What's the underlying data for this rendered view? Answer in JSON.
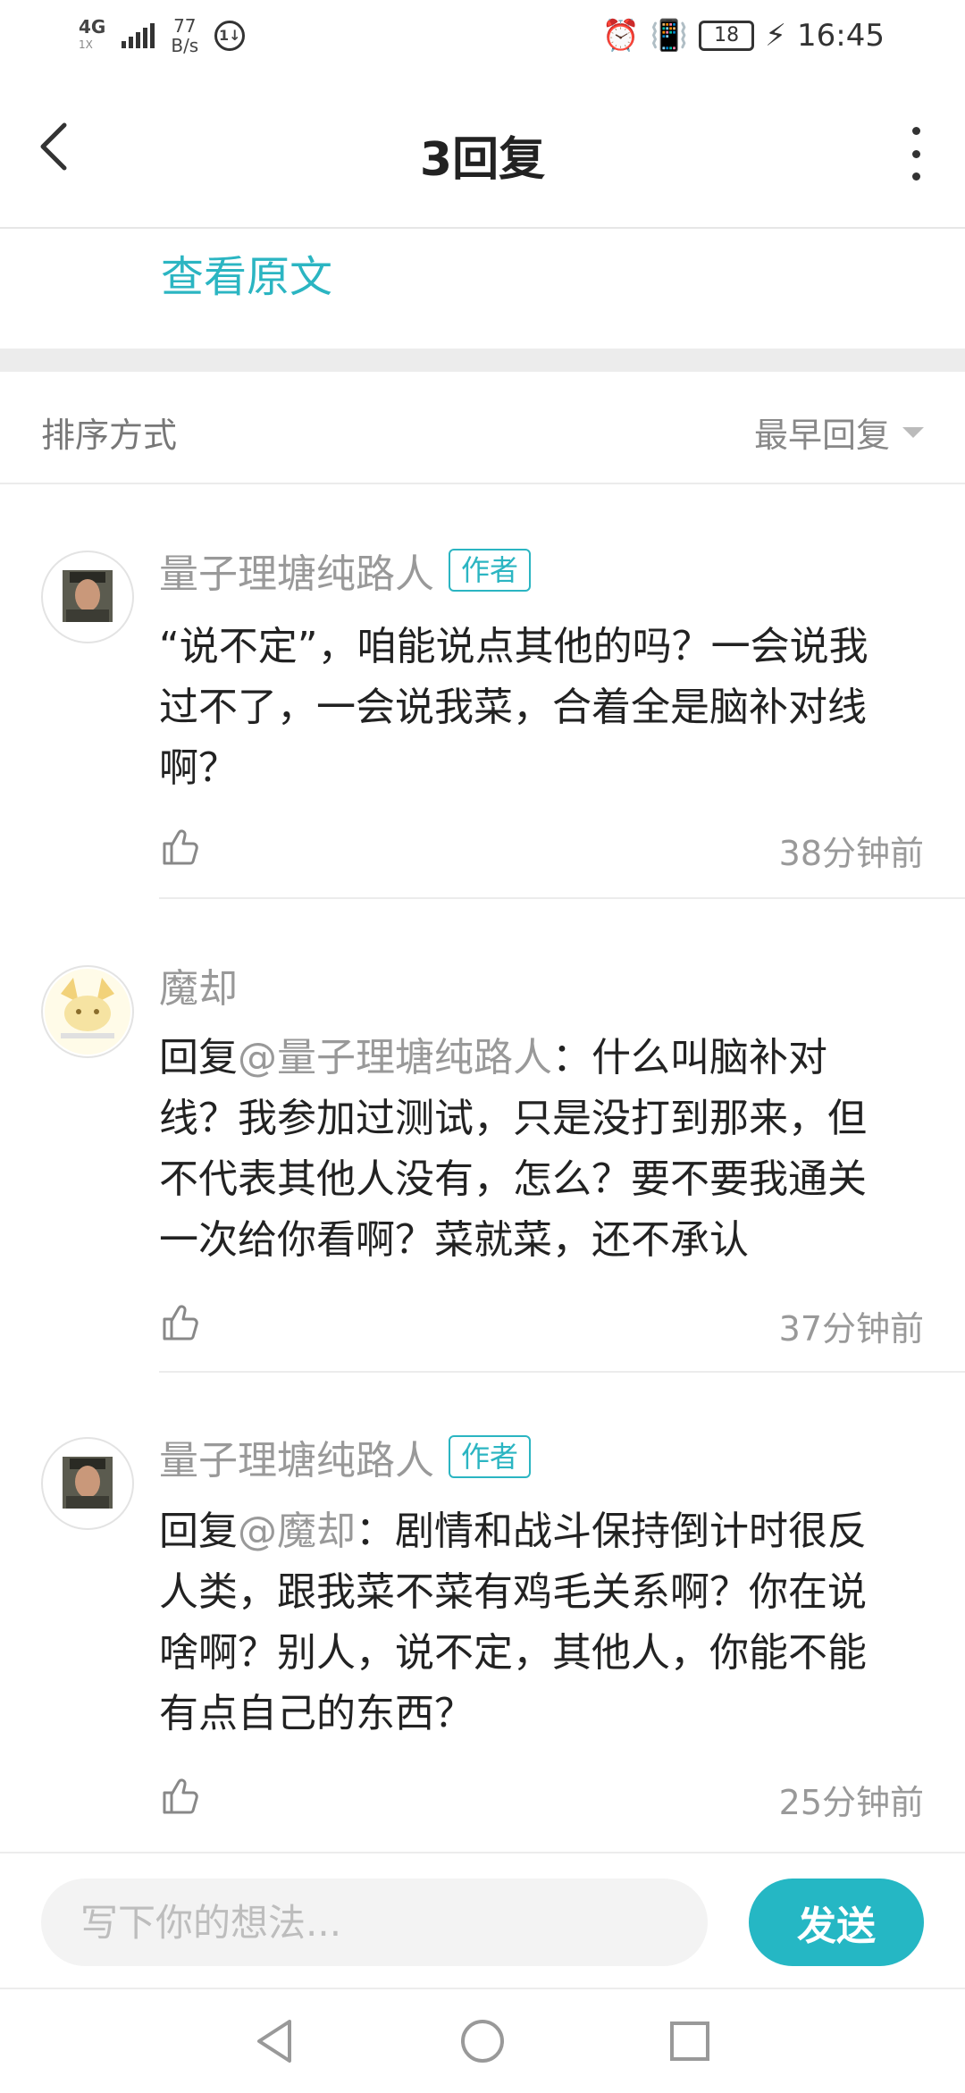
{
  "status_bar": {
    "network": "4G",
    "network_sub": "1X",
    "speed_value": "77",
    "speed_unit": "B/s",
    "data_saver_badge": "1↓",
    "battery": "18",
    "time": "16:45"
  },
  "header": {
    "title": "3回复"
  },
  "view_original_label": "查看原文",
  "sort": {
    "label": "排序方式",
    "value": "最早回复"
  },
  "comments": [
    {
      "name": "量子理塘纯路人",
      "badge": "作者",
      "mention": "",
      "reply_prefix": "",
      "text": "“说不定”，咱能说点其他的吗？一会说我过不了，一会说我菜，合着全是脑补对线啊？",
      "time": "38分钟前"
    },
    {
      "name": "魔却",
      "badge": "",
      "reply_prefix": "回复",
      "mention": "@量子理塘纯路人",
      "text": "：什么叫脑补对线？我参加过测试，只是没打到那来，但不代表其他人没有，怎么？要不要我通关一次给你看啊？菜就菜，还不承认",
      "time": "37分钟前"
    },
    {
      "name": "量子理塘纯路人",
      "badge": "作者",
      "reply_prefix": "回复",
      "mention": "@魔却",
      "text": "：剧情和战斗保持倒计时很反人类，跟我菜不菜有鸡毛关系啊？你在说啥啊？别人，说不定，其他人，你能不能有点自己的东西？",
      "time": "25分钟前"
    }
  ],
  "input": {
    "placeholder": "写下你的想法...",
    "value": ""
  },
  "send_label": "发送",
  "colors": {
    "accent": "#25b7c4",
    "muted_text": "#999999"
  }
}
